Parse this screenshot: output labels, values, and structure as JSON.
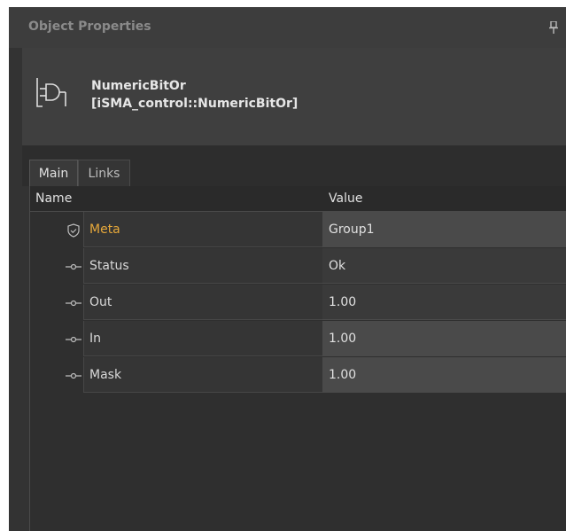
{
  "panel": {
    "title": "Object Properties"
  },
  "object": {
    "name": "NumericBitOr",
    "type": "[iSMA_control::NumericBitOr]"
  },
  "tabs": [
    {
      "label": "Main",
      "active": true
    },
    {
      "label": "Links",
      "active": false
    }
  ],
  "grid": {
    "col_name": "Name",
    "col_value": "Value",
    "rows": [
      {
        "icon": "shield-icon",
        "name": "Meta",
        "value": "Group1",
        "editable": true
      },
      {
        "icon": "slot-icon",
        "name": "Status",
        "value": "Ok",
        "editable": false
      },
      {
        "icon": "slot-icon",
        "name": "Out",
        "value": "1.00",
        "editable": false
      },
      {
        "icon": "slot-icon",
        "name": "In",
        "value": "1.00",
        "editable": true
      },
      {
        "icon": "slot-icon",
        "name": "Mask",
        "value": "1.00",
        "editable": true
      }
    ]
  },
  "colors": {
    "accent": "#e6a83a",
    "panel_bg": "#333333"
  }
}
